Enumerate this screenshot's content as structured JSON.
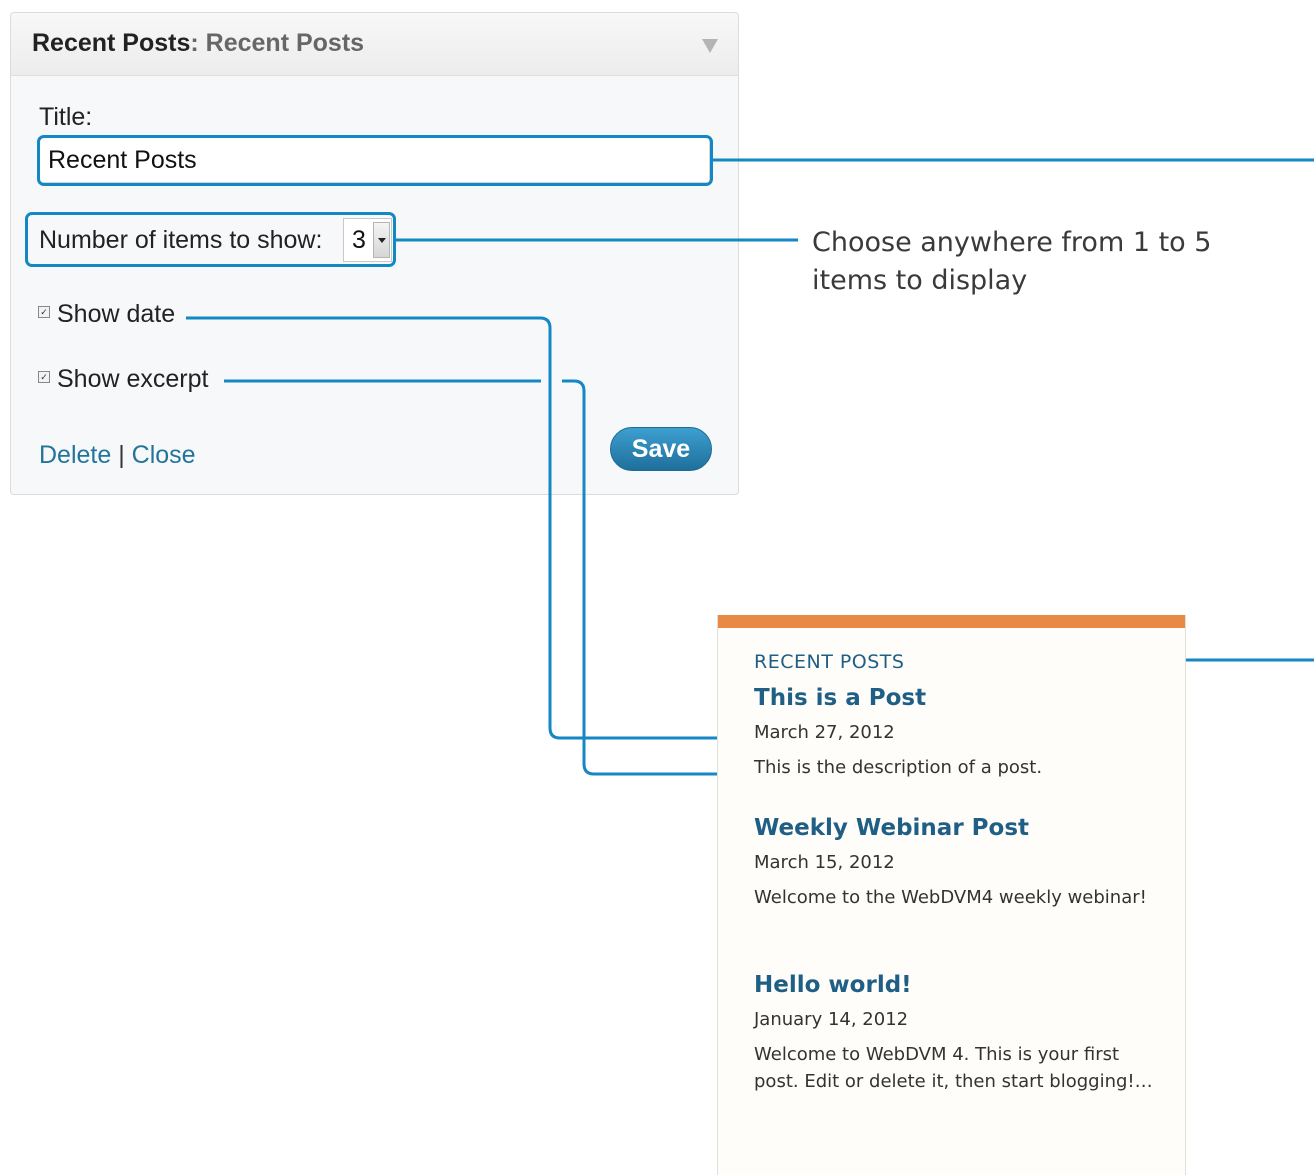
{
  "widget": {
    "title_main": "Recent Posts",
    "title_sub": ": Recent Posts",
    "title_label": "Title:",
    "title_value": "Recent Posts",
    "count_label": "Number of items to show:",
    "count_value": "3",
    "show_date_label": "Show date",
    "show_date_checked": true,
    "show_excerpt_label": "Show excerpt",
    "show_excerpt_checked": true,
    "delete_label": "Delete",
    "separator": "|",
    "close_label": "Close",
    "save_label": "Save"
  },
  "callout": {
    "count_note": "Choose anywhere from 1 to 5 items to display"
  },
  "preview": {
    "heading": "RECENT POSTS",
    "posts": [
      {
        "title": "This is a Post",
        "date": "March 27, 2012",
        "excerpt": "This is the description of a post."
      },
      {
        "title": "Weekly Webinar Post",
        "date": "March 15, 2012",
        "excerpt": "Welcome to the WebDVM4 weekly webinar!"
      },
      {
        "title": "Hello world!",
        "date": "January 14, 2012",
        "excerpt": "Welcome to WebDVM 4. This is your first post. Edit or delete it, then start blogging!…"
      }
    ]
  },
  "colors": {
    "accent_blue": "#1487c5",
    "link_blue": "#21759b",
    "preview_bar": "#e88a44",
    "post_title": "#1f5f86"
  },
  "icons": {
    "toggle": "triangle-down-icon",
    "checkbox": "checkbox-checked-icon",
    "dropdown": "chevron-down-icon"
  }
}
